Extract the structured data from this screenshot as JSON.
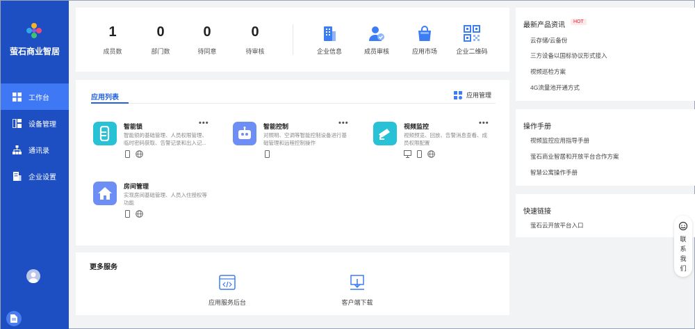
{
  "sidebar": {
    "brand": "萤石商业智居",
    "items": [
      {
        "label": "工作台",
        "icon": "grid-icon",
        "active": true
      },
      {
        "label": "设备管理",
        "icon": "device-icon"
      },
      {
        "label": "通讯录",
        "icon": "org-chart-icon"
      },
      {
        "label": "企业设置",
        "icon": "building-icon"
      }
    ]
  },
  "stats": [
    {
      "value": "1",
      "label": "成员数"
    },
    {
      "value": "0",
      "label": "部门数"
    },
    {
      "value": "0",
      "label": "待同意"
    },
    {
      "value": "0",
      "label": "待审核"
    }
  ],
  "quick_links": [
    {
      "label": "企业信息",
      "icon": "building-info-icon"
    },
    {
      "label": "成员审核",
      "icon": "member-review-icon"
    },
    {
      "label": "应用市场",
      "icon": "shopping-bag-icon"
    },
    {
      "label": "企业二维码",
      "icon": "qr-code-icon"
    }
  ],
  "apps": {
    "title": "应用列表",
    "manage_label": "应用管理",
    "items": [
      {
        "name": "智能锁",
        "desc": "智能锁的基础管理、人员权限管理、临时密码获取、告警记录和出入记...",
        "icon": "smart-lock-icon",
        "color": "#28c1d6"
      },
      {
        "name": "智能控制",
        "desc": "对照明、空调等智能控制设备进行基础管理和远程控制操作",
        "icon": "robot-icon",
        "color": "#6d8ef5"
      },
      {
        "name": "视频监控",
        "desc": "视频预览、回放、告警消息查看、成员权限配置",
        "icon": "camera-icon",
        "color": "#28c1d6"
      },
      {
        "name": "房间管理",
        "desc": "实现房间基础管理、人员入住授权等功能",
        "icon": "house-icon",
        "color": "#6d8ef5"
      }
    ]
  },
  "more_services": {
    "title": "更多服务",
    "items": [
      {
        "label": "应用服务后台",
        "icon": "code-window-icon"
      },
      {
        "label": "客户端下载",
        "icon": "download-icon"
      }
    ]
  },
  "news": {
    "title": "最新产品资讯",
    "badge": "HOT",
    "items": [
      "云存储/云备份",
      "三方设备以国标协议形式接入",
      "视频巡检方案",
      "4G流量池开通方式"
    ]
  },
  "manual": {
    "title": "操作手册",
    "items": [
      "视频监控应用指导手册",
      "萤石商业智居和开放平台合作方案",
      "智慧公寓操作手册"
    ]
  },
  "links": {
    "title": "快速链接",
    "items": [
      "萤石云开放平台入口"
    ]
  },
  "contact": {
    "label": "联系我们"
  },
  "colors": {
    "sidebar": "#1d4fc2",
    "active": "#3f78f5",
    "accent": "#1f5fe0"
  }
}
